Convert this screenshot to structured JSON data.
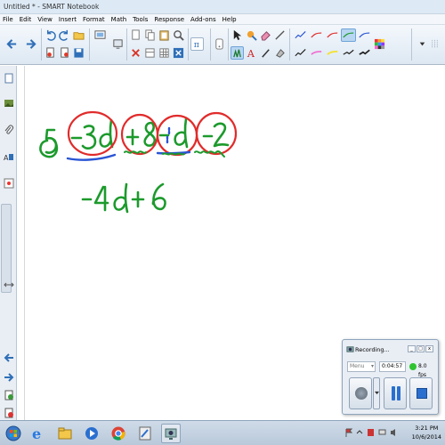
{
  "app": {
    "title": "Untitled * - SMART Notebook"
  },
  "menu": [
    "File",
    "Edit",
    "View",
    "Insert",
    "Format",
    "Math",
    "Tools",
    "Response",
    "Add-ons",
    "Help"
  ],
  "canvas": {
    "problem_number": "⑤",
    "expression_terms": [
      "-3d",
      "+8",
      "-d",
      "-2"
    ],
    "answer": "-4d + 6",
    "ink_colors": {
      "green": "#1c9a2c",
      "red": "#e12b2b",
      "blue": "#2a55d4"
    }
  },
  "recorder": {
    "title": "Recording...",
    "min_label": "_",
    "restore_label": "□",
    "close_label": "x",
    "mode_value": "Menu",
    "elapsed": "0:04:57",
    "fps": "8.0 fps"
  },
  "taskbar": {
    "time": "3:21 PM",
    "date": "10/6/2014"
  },
  "icons": {
    "accent": "#2f6fb8"
  }
}
